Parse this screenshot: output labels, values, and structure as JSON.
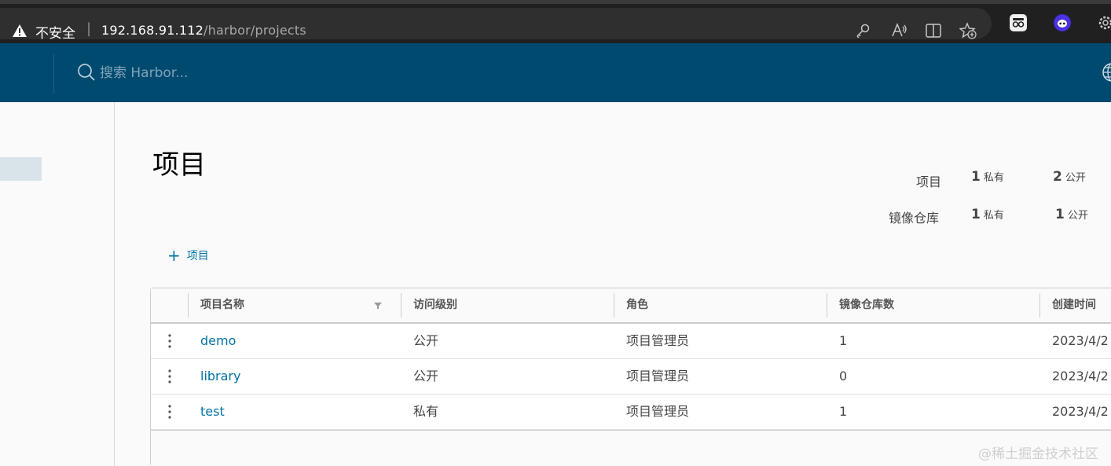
{
  "browser": {
    "security_label": "不安全",
    "url_host": "192.168.91.112",
    "url_path": "/harbor/projects",
    "colors": {
      "bar": "#202020",
      "urlbar": "#2f2f2f"
    }
  },
  "header": {
    "search_placeholder": "搜索 Harbor...",
    "background": "#004a70"
  },
  "page": {
    "title": "项目",
    "summary": {
      "projects_label": "项目",
      "projects_private": "1",
      "projects_public": "2",
      "repos_label": "镜像仓库",
      "repos_private": "1",
      "repos_public": "1",
      "private_unit": "私有",
      "public_unit": "公开"
    },
    "new_project_label": "项目"
  },
  "table": {
    "columns": [
      "项目名称",
      "访问级别",
      "角色",
      "镜像仓库数",
      "创建时间"
    ],
    "rows": [
      {
        "name": "demo",
        "access": "公开",
        "role": "项目管理员",
        "repo_count": "1",
        "created": "2023/4/2"
      },
      {
        "name": "library",
        "access": "公开",
        "role": "项目管理员",
        "repo_count": "0",
        "created": "2023/4/2"
      },
      {
        "name": "test",
        "access": "私有",
        "role": "项目管理员",
        "repo_count": "1",
        "created": "2023/4/2"
      }
    ]
  },
  "watermark": "@稀土掘金技术社区",
  "icons": [
    "warning-icon",
    "key-icon",
    "read-aloud-icon",
    "split-screen-icon",
    "favorites-add-icon",
    "extension-icon",
    "extension-icon-2",
    "settings-icon",
    "search-icon",
    "globe-icon",
    "plus-icon",
    "filter-icon",
    "kebab-icon"
  ],
  "accent": "#0072a3"
}
